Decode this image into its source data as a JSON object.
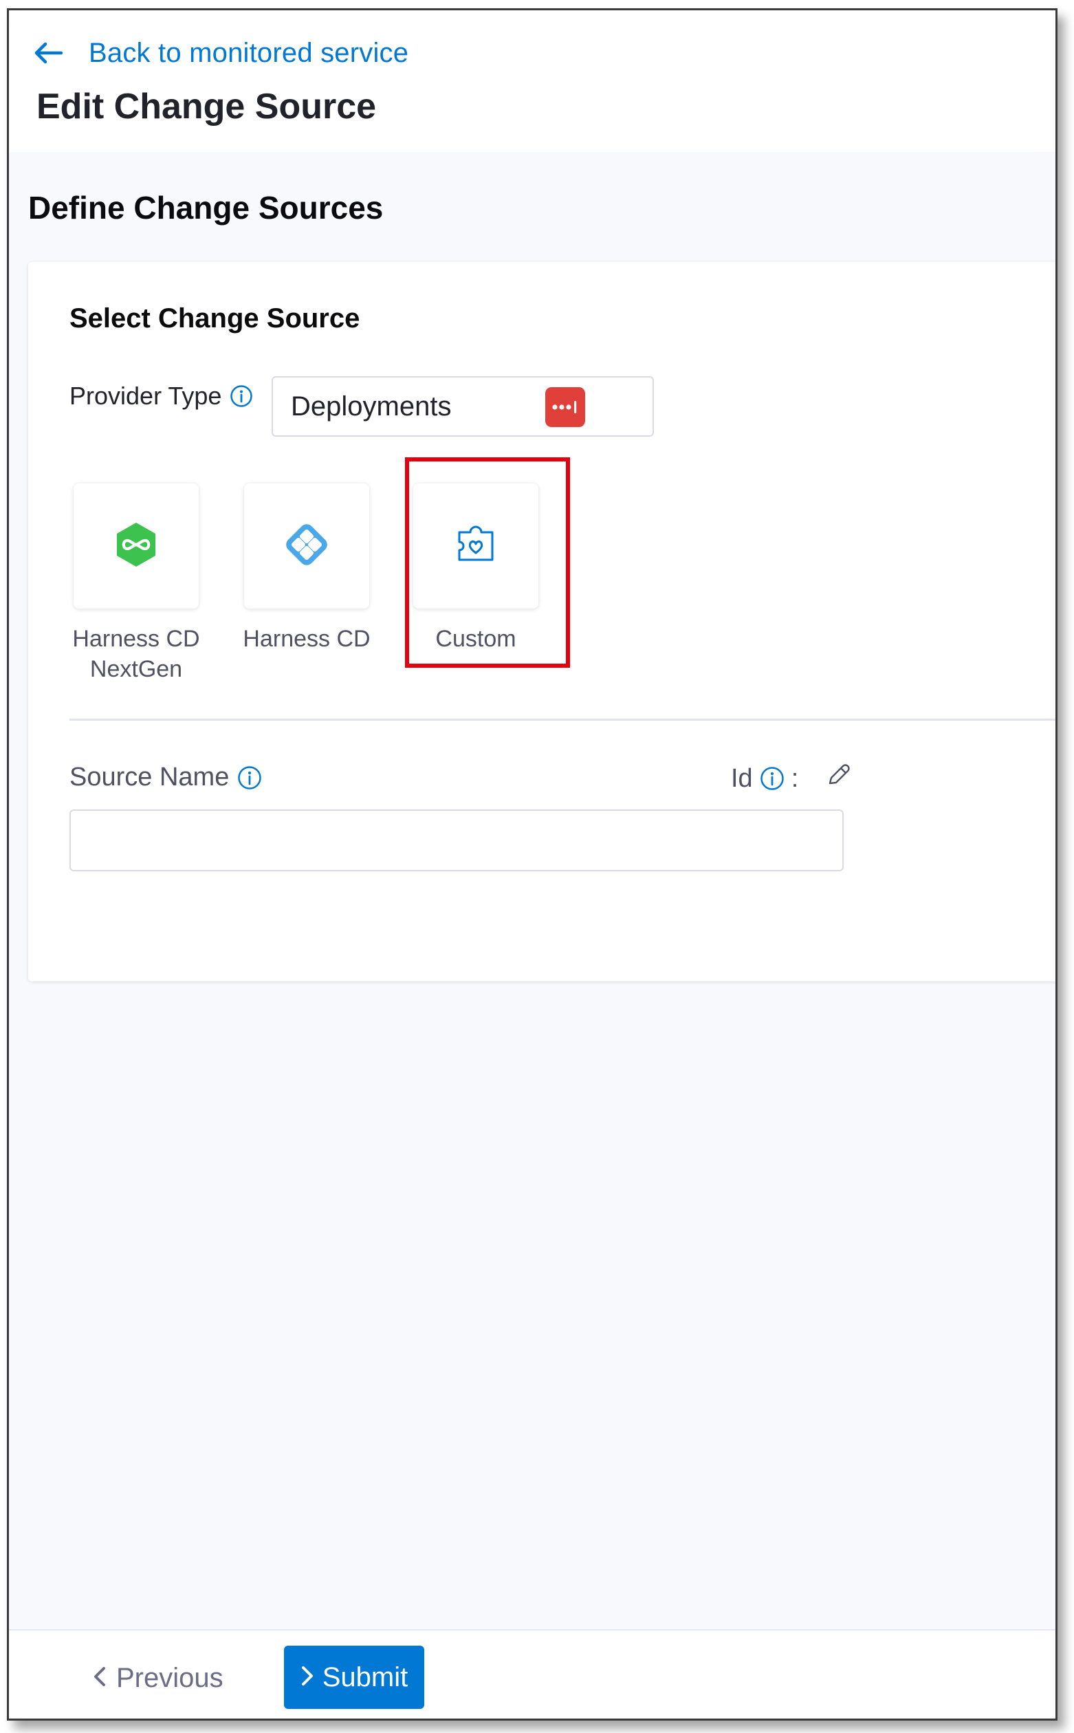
{
  "header": {
    "back_link_label": "Back to monitored service",
    "page_title": "Edit Change Source"
  },
  "main": {
    "section_title": "Define Change Sources",
    "card": {
      "title": "Select Change Source",
      "provider_type": {
        "label": "Provider Type",
        "selected_value": "Deployments"
      },
      "sources": [
        {
          "label": "Harness CD\nNextGen",
          "icon": "harness-cd-nextgen-icon",
          "selected": false
        },
        {
          "label": "Harness CD",
          "icon": "harness-cd-icon",
          "selected": false
        },
        {
          "label": "Custom",
          "icon": "custom-puzzle-heart-icon",
          "selected": true
        }
      ],
      "source_name": {
        "label": "Source Name",
        "value": "",
        "placeholder": ""
      },
      "id": {
        "label": "Id",
        "separator": ":"
      }
    }
  },
  "footer": {
    "previous_label": "Previous",
    "submit_label": "Submit"
  },
  "colors": {
    "primary": "#0278d5",
    "highlight": "#e3000f",
    "badge_red": "#e13f3a",
    "nextgen_green": "#3dc24f",
    "harness_cd_blue": "#4aa8e8",
    "background": "#f7f9fc"
  }
}
